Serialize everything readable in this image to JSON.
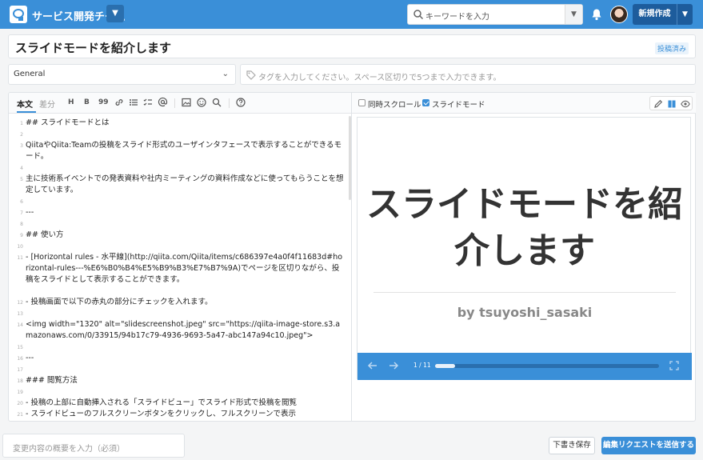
{
  "header": {
    "team_name": "サービス開発チーム",
    "search_placeholder": "キーワードを入力",
    "new_button": "新規作成"
  },
  "article": {
    "title": "スライドモードを紹介します",
    "status_badge": "投稿済み",
    "group": "General",
    "tags_placeholder": "タグを入力してください。スペース区切りで5つまで入力できます。"
  },
  "editor": {
    "tab_body": "本文",
    "tab_diff": "差分",
    "toolbar": [
      "H",
      "B",
      "99"
    ],
    "lines": [
      {
        "n": "1",
        "text": "## スライドモードとは"
      },
      {
        "n": "2",
        "text": ""
      },
      {
        "n": "3",
        "text": "QiitaやQiita:Teamの投稿をスライド形式のユーザインタフェースで表示することができるモード。"
      },
      {
        "n": "4",
        "text": ""
      },
      {
        "n": "5",
        "text": "主に技術系イベントでの発表資料や社内ミーティングの資料作成などに使ってもらうことを想定しています。"
      },
      {
        "n": "6",
        "text": ""
      },
      {
        "n": "7",
        "text": "---"
      },
      {
        "n": "8",
        "text": ""
      },
      {
        "n": "9",
        "text": "## 使い方"
      },
      {
        "n": "10",
        "text": ""
      },
      {
        "n": "11",
        "text": "- [Horizontal rules - 水平線](http://qiita.com/Qiita/items/c686397e4a0f4f11683d#horizontal-rules---%E6%B0%B4%E5%B9%B3%E7%B7%9A)でページを区切りながら、投稿をスライドとして表示することができます。"
      },
      {
        "n": "12",
        "text": "- 投稿画面で以下の赤丸の部分にチェックを入れます。"
      },
      {
        "n": "13",
        "text": ""
      },
      {
        "n": "14",
        "text": "<img width=\"1320\" alt=\"slidescreenshot.jpeg\" src=\"https://qiita-image-store.s3.amazonaws.com/0/33915/94b17c79-4936-9693-5a47-abc147a94c10.jpeg\">"
      },
      {
        "n": "15",
        "text": ""
      },
      {
        "n": "16",
        "text": "---"
      },
      {
        "n": "17",
        "text": ""
      },
      {
        "n": "18",
        "text": "### 閲覧方法"
      },
      {
        "n": "19",
        "text": ""
      },
      {
        "n": "20",
        "text": "- 投稿の上部に自動挿入される「スライドビュー」でスライド形式で投稿を閲覧"
      },
      {
        "n": "21",
        "text": "- スライドビューのフルスクリーンボタンをクリックし、フルスクリーンで表示"
      },
      {
        "n": "22",
        "text": ""
      }
    ]
  },
  "preview": {
    "sync_scroll_label": "同時スクロール",
    "sync_scroll_checked": false,
    "slide_mode_label": "スライドモード",
    "slide_mode_checked": true,
    "slide_title": "スライドモードを紹介します",
    "slide_author": "by tsuyoshi_sasaki",
    "page_indicator": "1 / 11",
    "progress": 0.0909
  },
  "footer": {
    "summary_placeholder": "変更内容の概要を入力（必須）",
    "draft_button": "下書き保存",
    "submit_button": "編集リクエストを送信する"
  },
  "colors": {
    "accent": "#3a8fd8",
    "header_dark": "#1d5c9c"
  }
}
